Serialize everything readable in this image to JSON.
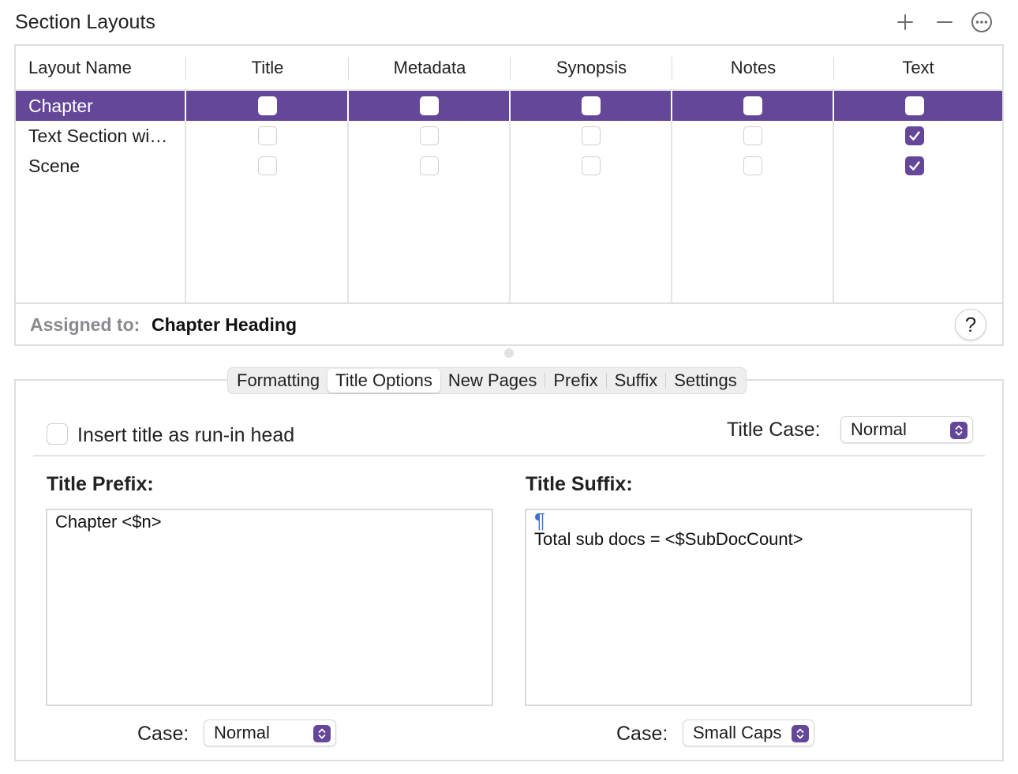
{
  "header": {
    "title": "Section Layouts",
    "add_icon": "plus-icon",
    "remove_icon": "minus-icon",
    "more_icon": "ellipsis-circle-icon"
  },
  "table": {
    "columns": [
      "Layout Name",
      "Title",
      "Metadata",
      "Synopsis",
      "Notes",
      "Text"
    ],
    "rows": [
      {
        "label": "Chapter",
        "selected": true,
        "checks": [
          false,
          false,
          false,
          false,
          false
        ]
      },
      {
        "label": "Text Section wi…",
        "selected": false,
        "checks": [
          false,
          false,
          false,
          false,
          true
        ]
      },
      {
        "label": "Scene",
        "selected": false,
        "checks": [
          false,
          false,
          false,
          false,
          true
        ]
      }
    ]
  },
  "assigned": {
    "label": "Assigned to:",
    "value": "Chapter Heading",
    "help": "?"
  },
  "tabs": [
    "Formatting",
    "Title Options",
    "New Pages",
    "Prefix",
    "Suffix",
    "Settings"
  ],
  "active_tab": "Title Options",
  "title_options": {
    "runin_label": "Insert title as run-in head",
    "runin_checked": false,
    "title_case_label": "Title Case:",
    "title_case_value": "Normal",
    "prefix_title": "Title Prefix:",
    "prefix_text": "Chapter <$n>",
    "suffix_title": "Title Suffix:",
    "suffix_pilcrow": "¶",
    "suffix_text": "Total sub docs = <$SubDocCount>",
    "prefix_case_label": "Case:",
    "prefix_case_value": "Normal",
    "suffix_case_label": "Case:",
    "suffix_case_value": "Small Caps"
  },
  "colors": {
    "accent": "#65479a",
    "border": "#dedede"
  }
}
